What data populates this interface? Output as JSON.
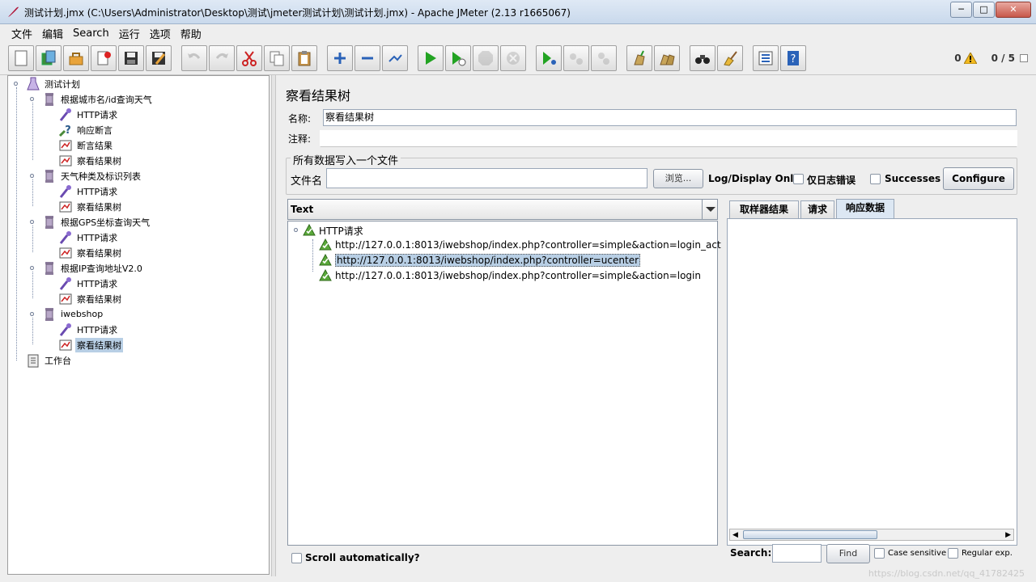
{
  "window": {
    "title": "测试计划.jmx (C:\\Users\\Administrator\\Desktop\\测试\\jmeter测试计划\\测试计划.jmx) - Apache JMeter (2.13 r1665067)",
    "minimize": "─",
    "maximize": "□",
    "close": "✕"
  },
  "menu": [
    "文件",
    "编辑",
    "Search",
    "运行",
    "选项",
    "帮助"
  ],
  "toolbar": {
    "error_count": "0",
    "threads": "0 / 5"
  },
  "tree": {
    "root": "测试计划",
    "groups": [
      {
        "label": "根据城市名/id查询天气",
        "children": [
          "HTTP请求",
          "响应断言",
          "断言结果",
          "察看结果树"
        ]
      },
      {
        "label": "天气种类及标识列表",
        "children": [
          "HTTP请求",
          "察看结果树"
        ]
      },
      {
        "label": "根据GPS坐标查询天气",
        "children": [
          "HTTP请求",
          "察看结果树"
        ]
      },
      {
        "label": "根据IP查询地址V2.0",
        "children": [
          "HTTP请求",
          "察看结果树"
        ]
      },
      {
        "label": "iwebshop",
        "children": [
          "HTTP请求",
          "察看结果树"
        ]
      }
    ],
    "workbench": "工作台"
  },
  "panel": {
    "title": "察看结果树",
    "name_label": "名称:",
    "name_value": "察看结果树",
    "comment_label": "注释:",
    "comment_value": "",
    "fieldset_title": "所有数据写入一个文件",
    "filename_label": "文件名",
    "filename_value": "",
    "browse_button": "浏览...",
    "log_display_label": "Log/Display Only:",
    "errors_only_label": "仅日志错误",
    "successes_label": "Successes",
    "configure_button": "Configure"
  },
  "results": {
    "renderer": "Text",
    "root": "HTTP请求",
    "samples": [
      "http://127.0.0.1:8013/iwebshop/index.php?controller=simple&action=login_act",
      "http://127.0.0.1:8013/iwebshop/index.php?controller=ucenter",
      "http://127.0.0.1:8013/iwebshop/index.php?controller=simple&action=login"
    ],
    "selected_index": 1,
    "scroll_auto_label": "Scroll automatically?"
  },
  "tabs": [
    "取样器结果",
    "请求",
    "响应数据"
  ],
  "active_tab": 2,
  "search": {
    "label": "Search:",
    "value": "",
    "find_button": "Find",
    "case_sensitive": "Case sensitive",
    "regular_exp": "Regular exp."
  },
  "watermark": "https://blog.csdn.net/qq_41782425",
  "colors": {
    "selection": "#b8cfe5",
    "titlebar": "#c9d9ec",
    "close_button": "#c7584a"
  }
}
